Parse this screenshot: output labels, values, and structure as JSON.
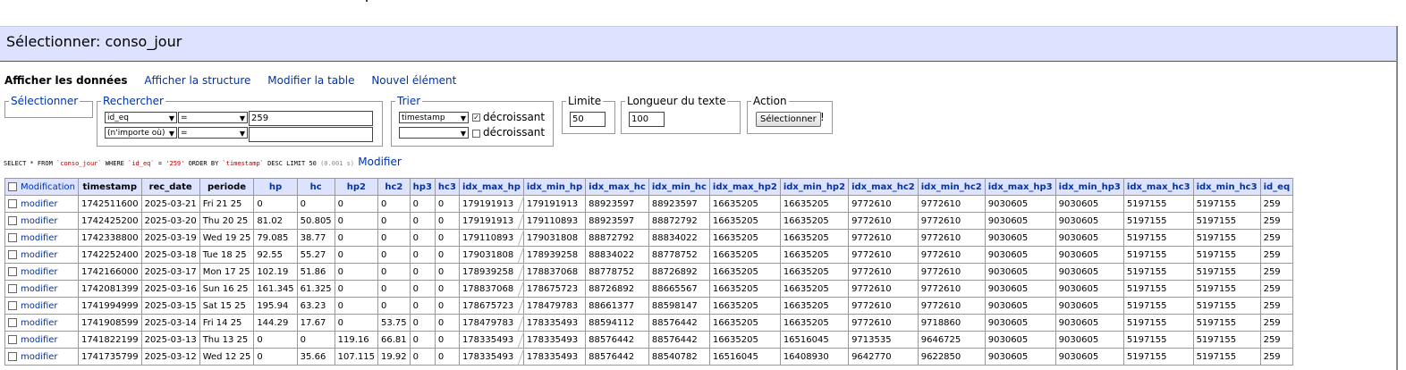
{
  "title": "Sélectionner: conso_jour",
  "links": {
    "show_data": "Afficher les données",
    "show_structure": "Afficher la structure",
    "edit_table": "Modifier la table",
    "new_item": "Nouvel élément"
  },
  "select_legend": "Sélectionner",
  "search": {
    "legend": "Rechercher",
    "row1_column": "id_eq",
    "row1_op": "=",
    "row1_value": "259",
    "row2_column": "(n'importe où)",
    "row2_op": "=",
    "row2_value": ""
  },
  "sort": {
    "legend": "Trier",
    "row1_column": "timestamp",
    "row1_desc_checked": true,
    "row1_desc_label": "décroissant",
    "row2_column": "",
    "row2_desc_checked": false,
    "row2_desc_label": "décroissant"
  },
  "limit": {
    "legend": "Limite",
    "value": "50"
  },
  "text_length": {
    "legend": "Longueur du texte",
    "value": "100"
  },
  "action": {
    "legend": "Action",
    "button": "Sélectionner",
    "suffix": "!"
  },
  "query": {
    "p1": "SELECT * FROM ",
    "table": "`conso_jour`",
    "p2": " WHERE ",
    "col": "`id_eq`",
    "p3": " = ",
    "val": "'259'",
    "p4": " ORDER BY ",
    "order": "`timestamp`",
    "p5": " DESC LIMIT 50 ",
    "time": "(0.001 s)",
    "edit_link": "Modifier"
  },
  "table": {
    "modification_header": "Modification",
    "columns": [
      "timestamp",
      "rec_date",
      "periode",
      "hp",
      "hc",
      "hp2",
      "hc2",
      "hp3",
      "hc3",
      "idx_max_hp",
      "idx_min_hp",
      "idx_max_hc",
      "idx_min_hc",
      "idx_max_hp2",
      "idx_min_hp2",
      "idx_max_hc2",
      "idx_min_hc2",
      "idx_max_hp3",
      "idx_min_hp3",
      "idx_max_hc3",
      "idx_min_hc3",
      "id_eq"
    ],
    "edit_label": "modifier",
    "rows": [
      [
        "1742511600",
        "2025-03-21",
        "Fri 21 25",
        "0",
        "0",
        "0",
        "0",
        "0",
        "0",
        "179191913",
        "179191913",
        "88923597",
        "88923597",
        "16635205",
        "16635205",
        "9772610",
        "9772610",
        "9030605",
        "9030605",
        "5197155",
        "5197155",
        "259"
      ],
      [
        "1742425200",
        "2025-03-20",
        "Thu 20 25",
        "81.02",
        "50.805",
        "0",
        "0",
        "0",
        "0",
        "179191913",
        "179110893",
        "88923597",
        "88872792",
        "16635205",
        "16635205",
        "9772610",
        "9772610",
        "9030605",
        "9030605",
        "5197155",
        "5197155",
        "259"
      ],
      [
        "1742338800",
        "2025-03-19",
        "Wed 19 25",
        "79.085",
        "38.77",
        "0",
        "0",
        "0",
        "0",
        "179110893",
        "179031808",
        "88872792",
        "88834022",
        "16635205",
        "16635205",
        "9772610",
        "9772610",
        "9030605",
        "9030605",
        "5197155",
        "5197155",
        "259"
      ],
      [
        "1742252400",
        "2025-03-18",
        "Tue 18 25",
        "92.55",
        "55.27",
        "0",
        "0",
        "0",
        "0",
        "179031808",
        "178939258",
        "88834022",
        "88778752",
        "16635205",
        "16635205",
        "9772610",
        "9772610",
        "9030605",
        "9030605",
        "5197155",
        "5197155",
        "259"
      ],
      [
        "1742166000",
        "2025-03-17",
        "Mon 17 25",
        "102.19",
        "51.86",
        "0",
        "0",
        "0",
        "0",
        "178939258",
        "178837068",
        "88778752",
        "88726892",
        "16635205",
        "16635205",
        "9772610",
        "9772610",
        "9030605",
        "9030605",
        "5197155",
        "5197155",
        "259"
      ],
      [
        "1742081399",
        "2025-03-16",
        "Sun 16 25",
        "161.345",
        "61.325",
        "0",
        "0",
        "0",
        "0",
        "178837068",
        "178675723",
        "88726892",
        "88665567",
        "16635205",
        "16635205",
        "9772610",
        "9772610",
        "9030605",
        "9030605",
        "5197155",
        "5197155",
        "259"
      ],
      [
        "1741994999",
        "2025-03-15",
        "Sat 15 25",
        "195.94",
        "63.23",
        "0",
        "0",
        "0",
        "0",
        "178675723",
        "178479783",
        "88661377",
        "88598147",
        "16635205",
        "16635205",
        "9772610",
        "9772610",
        "9030605",
        "9030605",
        "5197155",
        "5197155",
        "259"
      ],
      [
        "1741908599",
        "2025-03-14",
        "Fri 14 25",
        "144.29",
        "17.67",
        "0",
        "53.75",
        "0",
        "0",
        "178479783",
        "178335493",
        "88594112",
        "88576442",
        "16635205",
        "16635205",
        "9772610",
        "9718860",
        "9030605",
        "9030605",
        "5197155",
        "5197155",
        "259"
      ],
      [
        "1741822199",
        "2025-03-13",
        "Thu 13 25",
        "0",
        "0",
        "119.16",
        "66.81",
        "0",
        "0",
        "178335493",
        "178335493",
        "88576442",
        "88576442",
        "16635205",
        "16516045",
        "9713535",
        "9646725",
        "9030605",
        "9030605",
        "5197155",
        "5197155",
        "259"
      ],
      [
        "1741735799",
        "2025-03-12",
        "Wed 12 25",
        "0",
        "35.66",
        "107.115",
        "19.92",
        "0",
        "0",
        "178335493",
        "178335493",
        "88576442",
        "88540782",
        "16516045",
        "16408930",
        "9642770",
        "9622850",
        "9030605",
        "9030605",
        "5197155",
        "5197155",
        "259"
      ]
    ]
  }
}
